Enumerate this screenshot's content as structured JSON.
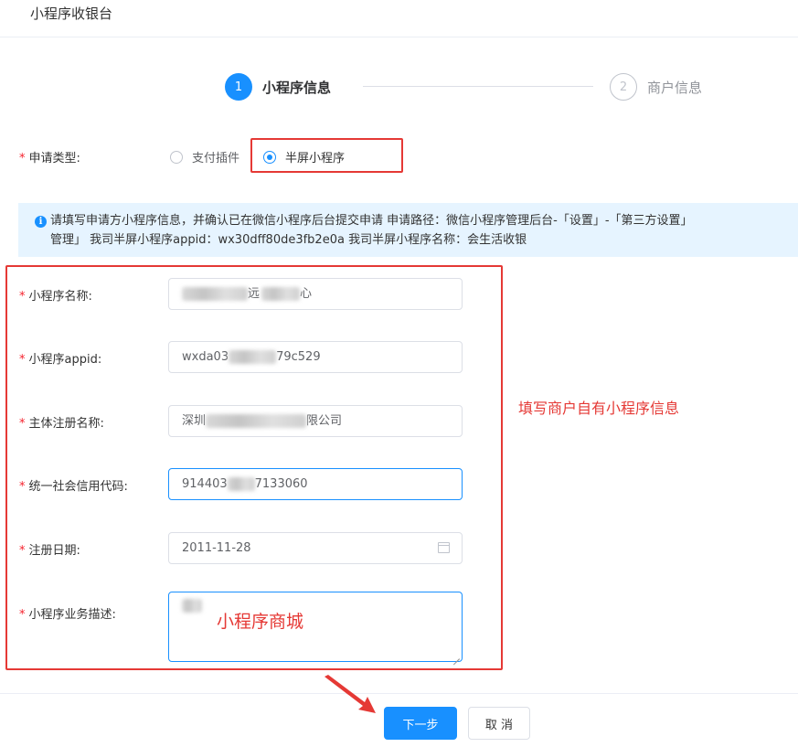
{
  "page": {
    "title": "小程序收银台"
  },
  "steps": [
    {
      "number": "1",
      "label": "小程序信息",
      "active": true
    },
    {
      "number": "2",
      "label": "商户信息",
      "active": false
    }
  ],
  "application_type": {
    "label": "申请类型:",
    "required_mark": "*",
    "options": [
      {
        "label": "支付插件",
        "selected": false
      },
      {
        "label": "半屏小程序",
        "selected": true
      }
    ]
  },
  "alert": {
    "icon": "info-icon",
    "icon_glyph": "i",
    "line1": "请填写申请方小程序信息，并确认已在微信小程序后台提交申请 申请路径：微信小程序管理后台-「设置」-「第三方设置」",
    "line2": "管理」 我司半屏小程序appid：wx30dff80de3fb2e0a 我司半屏小程序名称：会生活收银"
  },
  "form": {
    "required_mark": "*",
    "fields": {
      "mini_name": {
        "label": "小程序名称:",
        "visible_fragment_1": "远",
        "visible_fragment_2": "心"
      },
      "appid": {
        "label": "小程序appid:",
        "prefix": "wxda03",
        "suffix": "79c529"
      },
      "entity_name": {
        "label": "主体注册名称:",
        "prefix": "深圳",
        "suffix": "限公司"
      },
      "credit_code": {
        "label": "统一社会信用代码:",
        "prefix": "914403",
        "suffix": "7133060"
      },
      "reg_date": {
        "label": "注册日期:",
        "value": "2011-11-28",
        "icon": "calendar-icon"
      },
      "description": {
        "label": "小程序业务描述:",
        "annotation": "小程序商城"
      }
    },
    "side_annotation": "填写商户自有小程序信息"
  },
  "footer": {
    "next_label": "下一步",
    "cancel_label": "取 消"
  },
  "colors": {
    "primary": "#1890ff",
    "annotation_red": "#e53935",
    "required_red": "#f5222d",
    "alert_bg": "#e6f4ff"
  }
}
